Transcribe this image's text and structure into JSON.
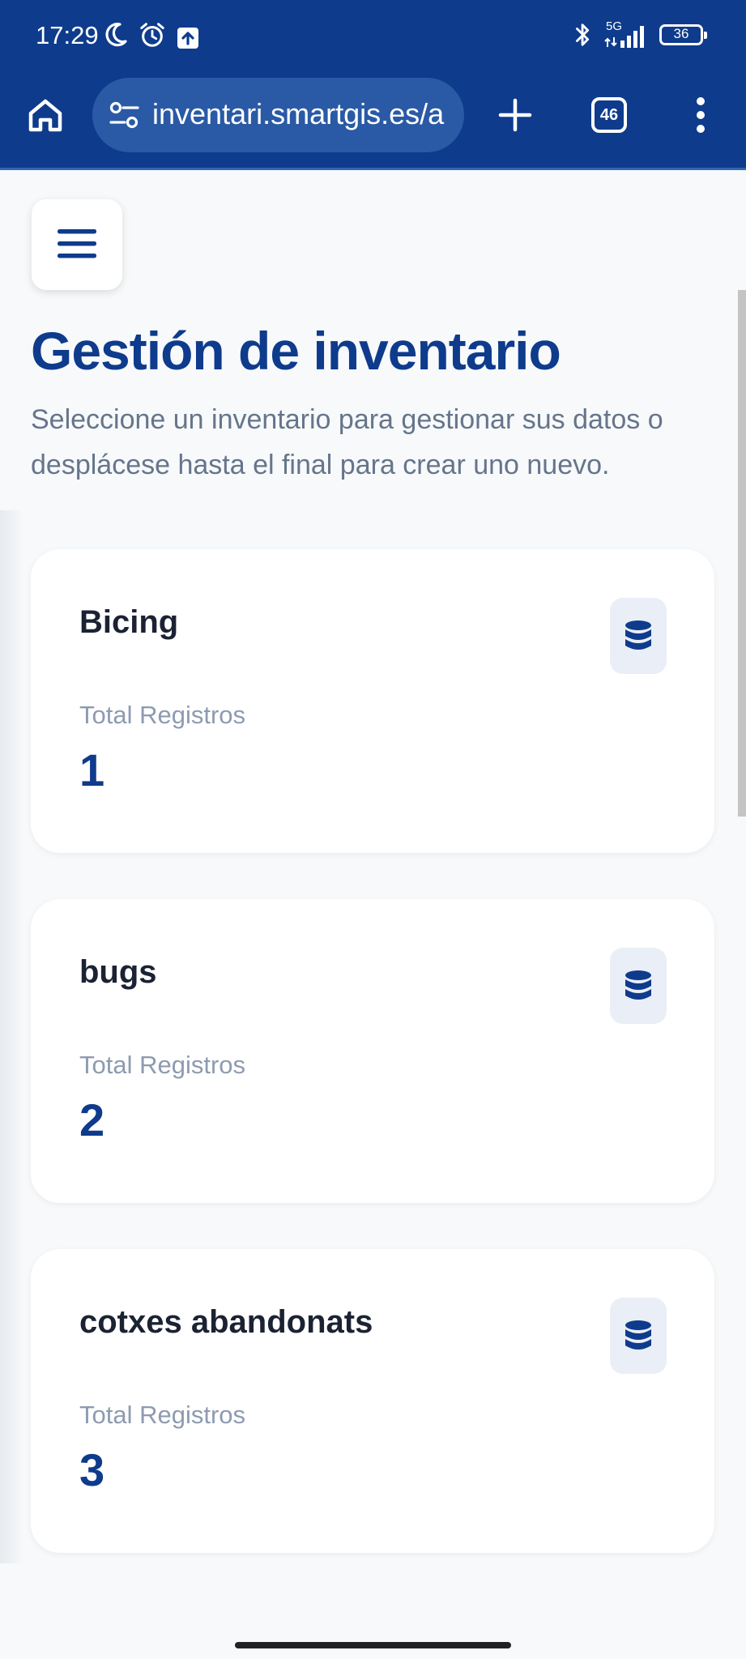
{
  "status_bar": {
    "time": "17:29",
    "network": "5G",
    "battery": "36",
    "icons": [
      "moon-icon",
      "alarm-icon",
      "upload-icon",
      "bluetooth-icon",
      "signal-icon",
      "battery-icon"
    ]
  },
  "browser": {
    "url": "inventari.smartgis.es/a",
    "tab_count": "46",
    "icons": [
      "home-icon",
      "site-settings-icon",
      "plus-icon",
      "tabs-icon",
      "more-vert-icon"
    ]
  },
  "page": {
    "title": "Gestión de inventario",
    "subtitle": "Seleccione un inventario para gestionar sus datos o desplácese hasta el final para crear uno nuevo."
  },
  "inventories": [
    {
      "name": "Bicing",
      "label": "Total Registros",
      "count": "1"
    },
    {
      "name": "bugs",
      "label": "Total Registros",
      "count": "2"
    },
    {
      "name": "cotxes abandonats",
      "label": "Total Registros",
      "count": "3"
    }
  ],
  "colors": {
    "brand": "#0e3b8c",
    "heading": "#0e3b8c",
    "card_title": "#1b2233",
    "muted": "#8d9bb0",
    "icon_tile": "#e9eef7",
    "page_bg": "#f7f9fb"
  }
}
